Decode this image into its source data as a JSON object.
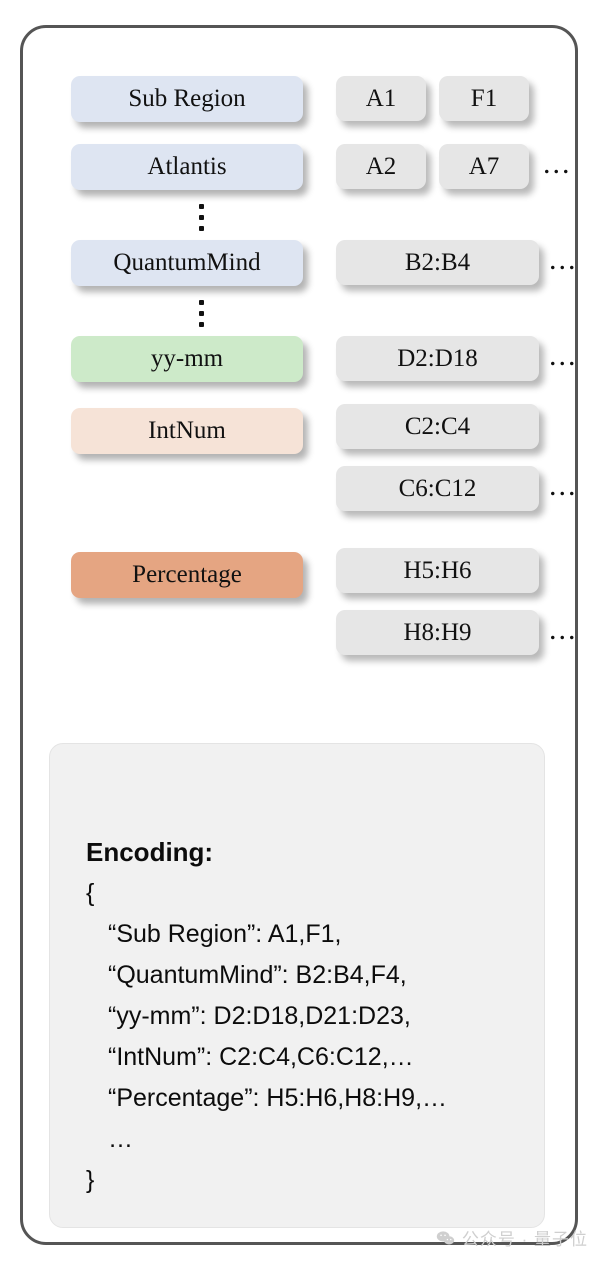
{
  "diagram": {
    "rows": [
      {
        "label": "Sub Region",
        "label_color": "blue",
        "chips": [
          "A1",
          "F1"
        ],
        "chip_size": "small",
        "ellipsis": ""
      },
      {
        "label": "Atlantis",
        "label_color": "blue",
        "chips": [
          "A2",
          "A7"
        ],
        "chip_size": "small",
        "ellipsis": "..."
      },
      {
        "label": "QuantumMind",
        "label_color": "blue",
        "chips": [
          "B2:B4"
        ],
        "chip_size": "wide",
        "ellipsis": "..."
      },
      {
        "label": "yy-mm",
        "label_color": "green",
        "chips": [
          "D2:D18"
        ],
        "chip_size": "wide",
        "ellipsis": "..."
      }
    ],
    "stacked_rows": [
      {
        "label": "IntNum",
        "label_color": "peach",
        "chip_top": "C2:C4",
        "chip_bottom": "C6:C12",
        "ellipsis": "..."
      },
      {
        "label": "Percentage",
        "label_color": "orange",
        "chip_top": "H5:H6",
        "chip_bottom": "H8:H9",
        "ellipsis": "..."
      }
    ],
    "vertical_ellipsis": "⋮"
  },
  "encoding": {
    "title": "Encoding:",
    "open_brace": "{",
    "lines": [
      "“Sub Region”: A1,F1,",
      "“QuantumMind”: B2:B4,F4,",
      "“yy-mm”: D2:D18,D21:D23,",
      "“IntNum”: C2:C4,C6:C12,…",
      "“Percentage”: H5:H6,H8:H9,…",
      "…"
    ],
    "close_brace": "}"
  },
  "watermark": {
    "text": "公众号 · 量子位"
  },
  "colors": {
    "blue": "#dee5f2",
    "green": "#cdeac9",
    "peach": "#f6e3d7",
    "orange": "#e5a582",
    "chip_gray": "#e6e6e6",
    "frame_border": "#555555",
    "encoding_bg": "#f1f1f1"
  }
}
